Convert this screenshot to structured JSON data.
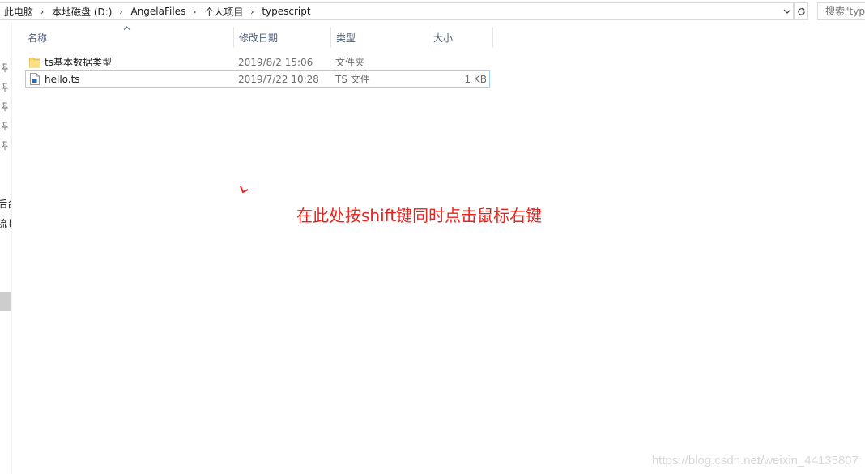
{
  "address_bar": {
    "breadcrumbs": [
      "此电脑",
      "本地磁盘 (D:)",
      "AngelaFiles",
      "个人项目",
      "typescript"
    ],
    "search_placeholder": "搜索\"typescript\""
  },
  "nav": {
    "fragments": [
      "后台",
      "流し"
    ]
  },
  "columns": {
    "name": "名称",
    "date": "修改日期",
    "type": "类型",
    "size": "大小"
  },
  "files": [
    {
      "name": "ts基本数据类型",
      "date": "2019/8/2 15:06",
      "type": "文件夹",
      "size": "",
      "icon": "folder-icon",
      "selected": false
    },
    {
      "name": "hello.ts",
      "date": "2019/7/22 10:28",
      "type": "TS 文件",
      "size": "1 KB",
      "icon": "ts-file-icon",
      "selected": true
    }
  ],
  "annotation": {
    "text": "在此处按shift键同时点击鼠标右键",
    "color": "#e8231d"
  },
  "watermark": "https://blog.csdn.net/weixin_44135807",
  "colors": {
    "header_text": "#4c607a",
    "selection_border": "#99d1ff",
    "folder": "#f7d366"
  }
}
